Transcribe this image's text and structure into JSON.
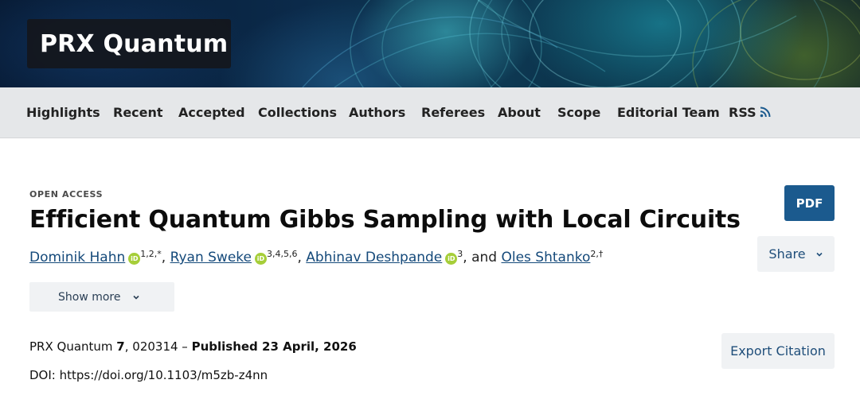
{
  "header": {
    "journal_name": "PRX Quantum"
  },
  "nav": {
    "items": [
      {
        "label": "Highlights"
      },
      {
        "label": "Recent"
      },
      {
        "label": "Accepted"
      },
      {
        "label": "Collections"
      },
      {
        "label": "Authors"
      },
      {
        "label": "Referees"
      },
      {
        "label": "About"
      },
      {
        "label": "Scope"
      },
      {
        "label": "Editorial Team"
      },
      {
        "label": "RSS",
        "icon": "rss-icon"
      }
    ]
  },
  "article": {
    "access_label": "OPEN ACCESS",
    "title": "Efficient Quantum Gibbs Sampling with Local Circuits",
    "authors": [
      {
        "name": "Dominik Hahn",
        "orcid": true,
        "affiliations": "1,2,*"
      },
      {
        "name": "Ryan Sweke",
        "orcid": true,
        "affiliations": "3,4,5,6"
      },
      {
        "name": "Abhinav Deshpande",
        "orcid": true,
        "affiliations": "3"
      },
      {
        "name": "Oles Shtanko",
        "orcid": false,
        "affiliations": "2,†"
      }
    ],
    "author_separator": ", ",
    "author_conjunction": ", and ",
    "orcid_icon_text": "iD",
    "show_more_label": "Show more",
    "citation": {
      "journal": "PRX Quantum ",
      "volume": "7",
      "article_number": ", 020314 – ",
      "published": "Published 23 April, 2026"
    },
    "doi": "DOI: https://doi.org/10.1103/m5zb-z4nn"
  },
  "actions": {
    "pdf_label": "PDF",
    "share_label": "Share",
    "export_label": "Export Citation"
  },
  "colors": {
    "accent": "#1b5a8e",
    "link": "#14497a",
    "orcid": "#a6ce39",
    "nav_bg": "#e5e7e9",
    "button_bg": "#f0f2f4"
  }
}
